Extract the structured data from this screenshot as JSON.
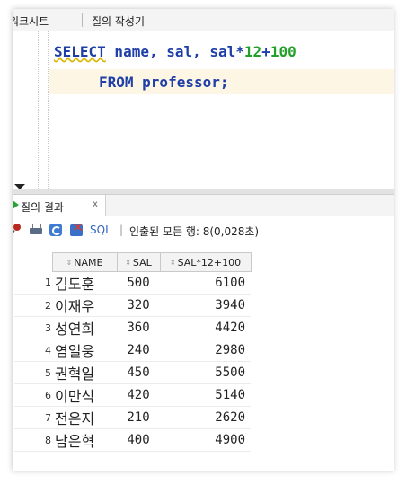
{
  "tabs": {
    "worksheet_label": "워크시트",
    "query_builder_label": "질의 작성기"
  },
  "editor": {
    "line1": {
      "kw": "SELECT",
      "rest": " name, sal, sal*",
      "num1": "12",
      "plus": "+",
      "num2": "100"
    },
    "line2": {
      "kw": "FROM",
      "rest": " professor;"
    }
  },
  "results_tab": {
    "label": "질의 결과",
    "close": "x"
  },
  "toolbar": {
    "sql_label": "SQL",
    "separator": "|",
    "status": "인출된 모든 행: 8(0,028초)",
    "icons": [
      "pin-icon",
      "print-icon",
      "refresh-icon",
      "export-icon"
    ]
  },
  "grid": {
    "columns": [
      "NAME",
      "SAL",
      "SAL*12+100"
    ],
    "rows": [
      {
        "n": "1",
        "name": "김도훈",
        "sal": "500",
        "annual": "6100"
      },
      {
        "n": "2",
        "name": "이재우",
        "sal": "320",
        "annual": "3940"
      },
      {
        "n": "3",
        "name": "성연희",
        "sal": "360",
        "annual": "4420"
      },
      {
        "n": "4",
        "name": "염일웅",
        "sal": "240",
        "annual": "2980"
      },
      {
        "n": "5",
        "name": "권혁일",
        "sal": "450",
        "annual": "5500"
      },
      {
        "n": "6",
        "name": "이만식",
        "sal": "420",
        "annual": "5140"
      },
      {
        "n": "7",
        "name": "전은지",
        "sal": "210",
        "annual": "2620"
      },
      {
        "n": "8",
        "name": "남은혁",
        "sal": "400",
        "annual": "4900"
      }
    ]
  }
}
